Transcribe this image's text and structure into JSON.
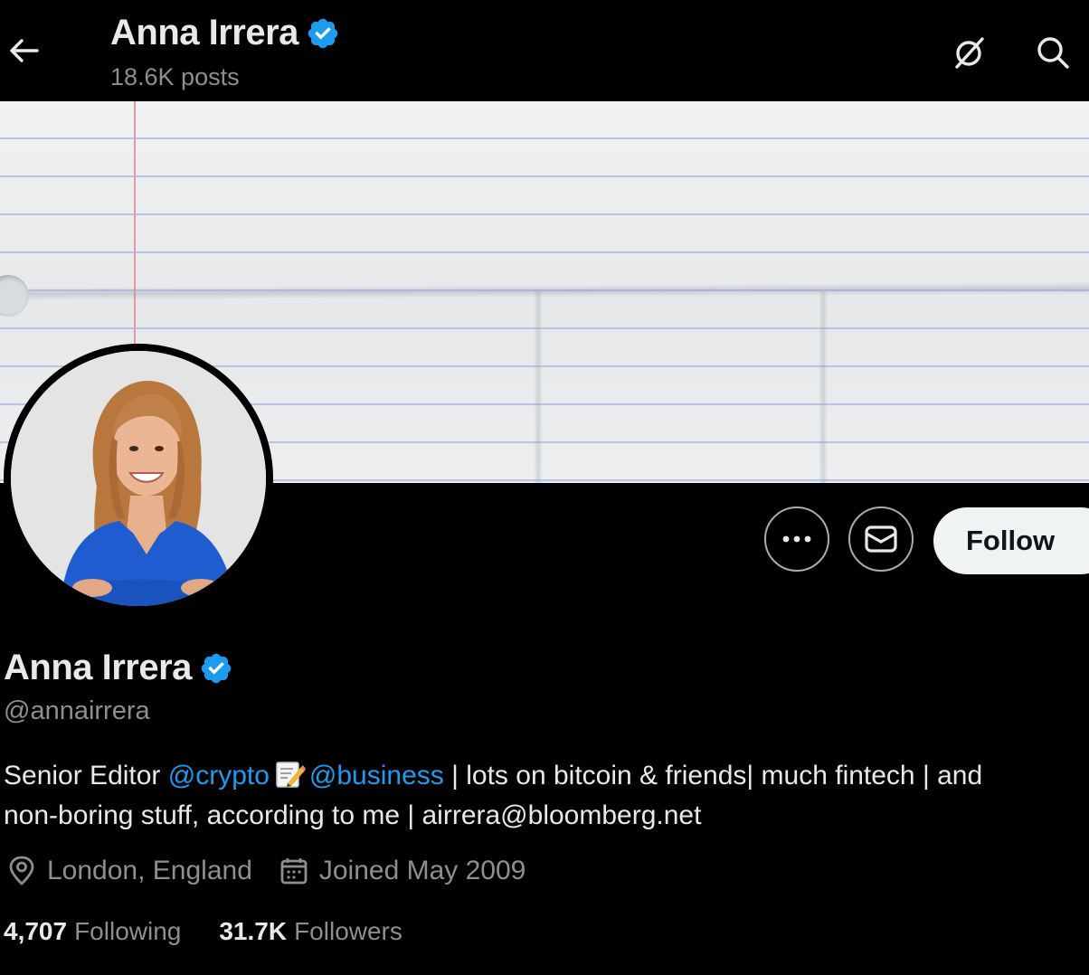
{
  "header": {
    "title": "Anna Irrera",
    "posts": "18.6K posts"
  },
  "profile": {
    "name": "Anna Irrera",
    "handle": "@annairrera",
    "follow_label": "Follow",
    "bio": {
      "prefix": "Senior Editor ",
      "mention1": "@crypto",
      "mention2": "@business",
      "line1_rest": " | lots on bitcoin & friends| much fintech | and",
      "line2": "non-boring stuff, according to me | airrera@bloomberg.net"
    },
    "location": "London, England",
    "joined": "Joined May 2009",
    "following_count": "4,707",
    "following_label": "Following",
    "followers_count": "31.7K",
    "followers_label": "Followers"
  },
  "colors": {
    "background": "#000000",
    "link": "#1d9bf0",
    "verified": "#1d9bf0",
    "secondary_text": "#8b8f94",
    "follow_bg": "#eff3f4"
  },
  "icons": [
    "back-arrow-icon",
    "grok-icon",
    "search-icon",
    "more-icon",
    "mail-icon",
    "verified-badge-icon",
    "location-icon",
    "calendar-icon",
    "memo-emoji-icon"
  ]
}
